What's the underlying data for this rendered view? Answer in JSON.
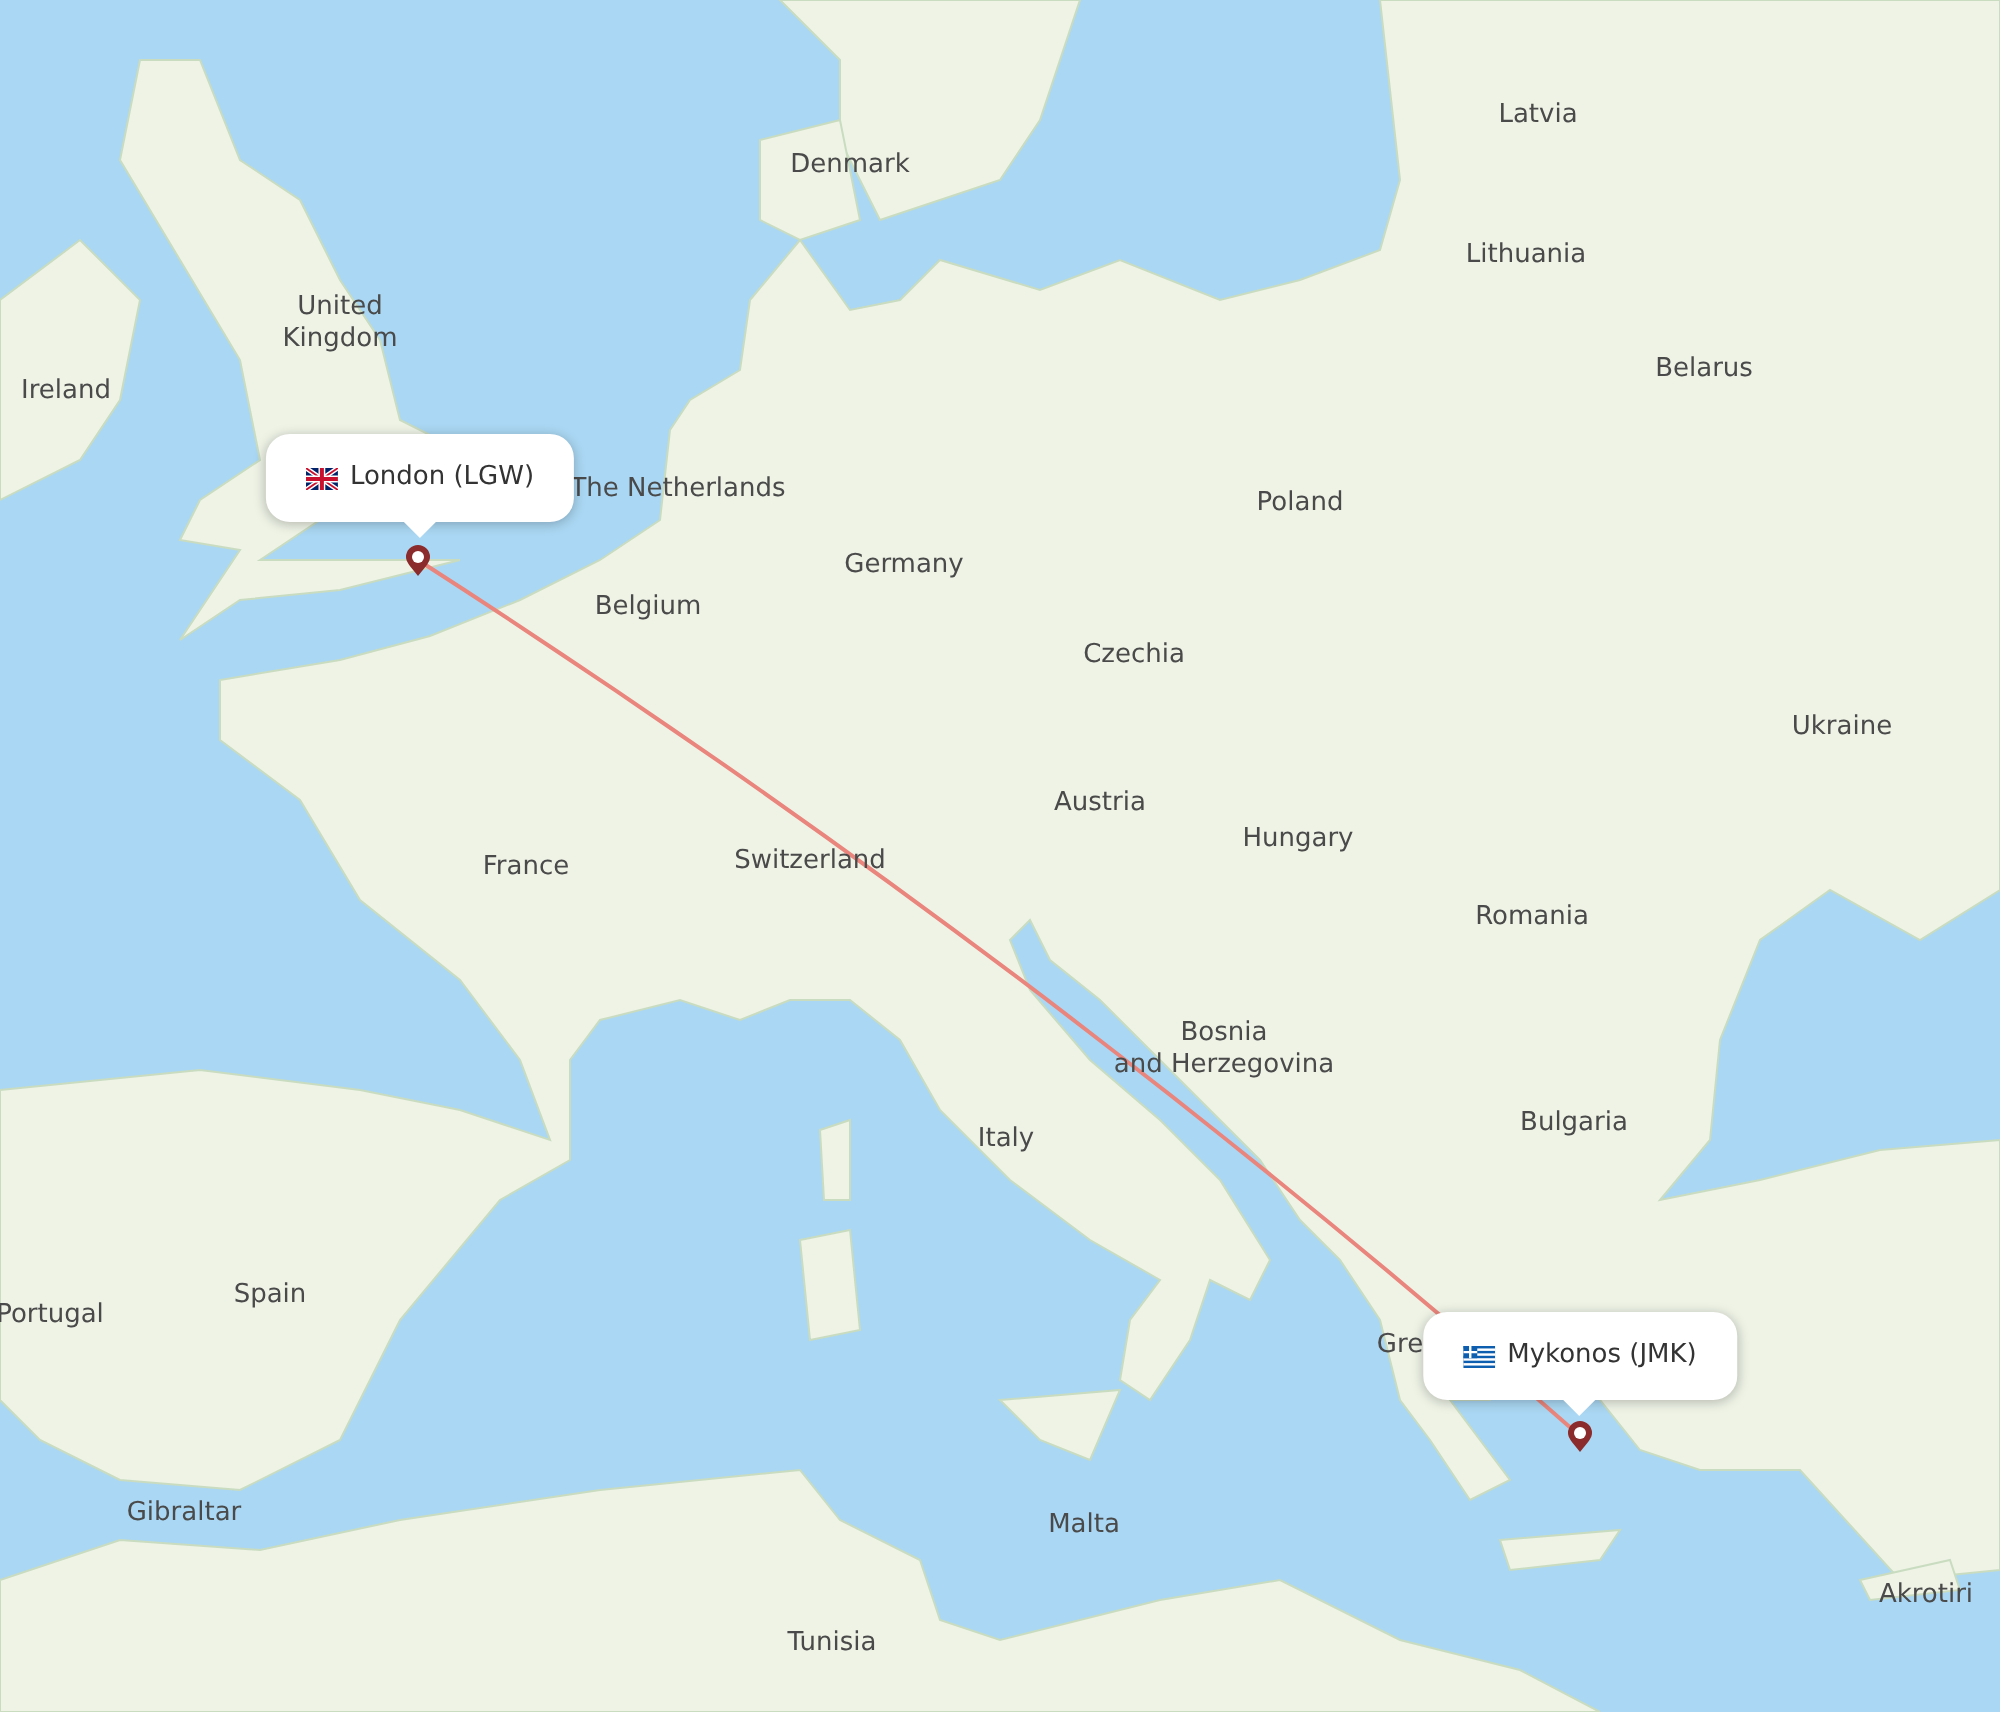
{
  "map_labels": [
    "Latvia",
    "Denmark",
    "Lithuania",
    "United\nKingdom",
    "Belarus",
    "Ireland",
    "The Netherlands",
    "Poland",
    "Germany",
    "Belgium",
    "Czechia",
    "Ukraine",
    "Austria",
    "Hungary",
    "France",
    "Switzerland",
    "Romania",
    "Bosnia\nand Herzegovina",
    "Bulgaria",
    "Italy",
    "Spain",
    "Portugal",
    "Gre",
    "Gibraltar",
    "Malta",
    "Akrotiri",
    "Tunisia"
  ],
  "origin": {
    "label": "London (LGW)"
  },
  "destination": {
    "label": "Mykonos (JMK)"
  }
}
